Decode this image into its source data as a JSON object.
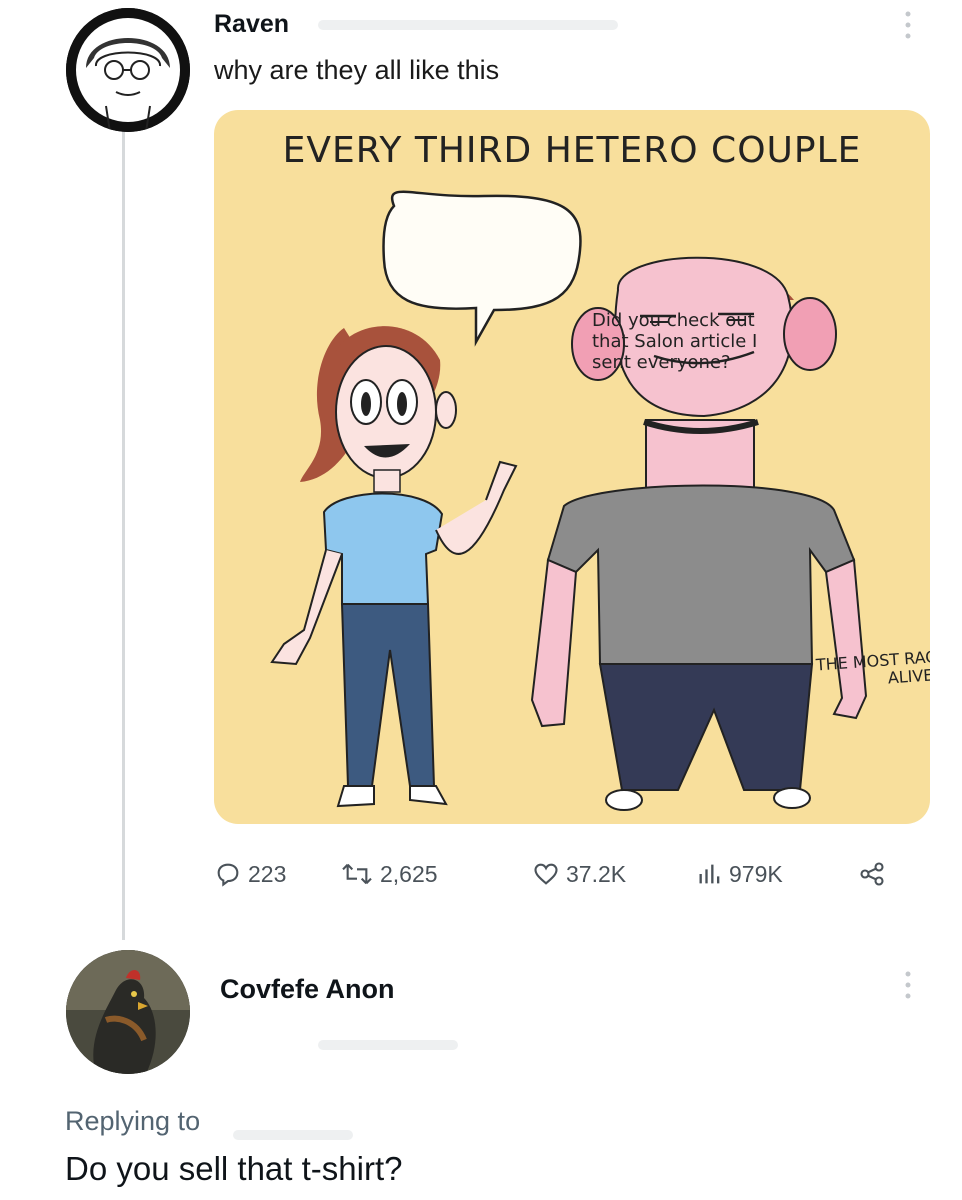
{
  "tweet": {
    "author": "Raven",
    "text": "why are they all like this",
    "comic": {
      "title": "EVERY THIRD HETERO COUPLE",
      "speech": "Did you check out that Salon article I sent everyone?",
      "shirt": "THE MOST RACIST MAN ALIVE"
    },
    "stats": {
      "replies": "223",
      "retweets": "2,625",
      "likes": "37.2K",
      "views": "979K"
    }
  },
  "reply": {
    "author": "Covfefe Anon",
    "replying_label": "Replying to",
    "text": "Do you sell that t-shirt?"
  },
  "icons": {
    "reply": "reply-icon",
    "retweet": "retweet-icon",
    "like": "heart-icon",
    "views": "views-icon",
    "share": "share-icon",
    "more": "more-vertical-icon"
  }
}
